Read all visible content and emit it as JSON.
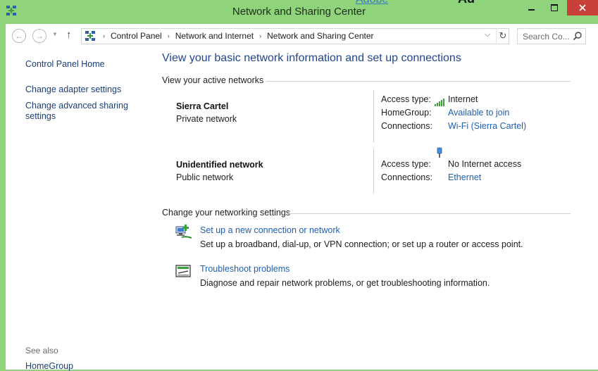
{
  "window": {
    "title": "Network and Sharing Center",
    "peek_text_1": "Adobe",
    "peek_text_2": "Ad"
  },
  "nav": {
    "back": "←",
    "forward": "→",
    "recent": "▼",
    "up": "↑"
  },
  "address": {
    "crumbs": [
      "Control Panel",
      "Network and Internet",
      "Network and Sharing Center"
    ],
    "separator": "›",
    "dropdown": "⌵",
    "refresh": "↻"
  },
  "search": {
    "placeholder": "Search Co..."
  },
  "sidebar": {
    "items": [
      {
        "label": "Control Panel Home"
      },
      {
        "label": "Change adapter settings"
      },
      {
        "label": "Change advanced sharing settings"
      }
    ],
    "see_also": "See also",
    "see_also_items": [
      {
        "label": "HomeGroup"
      }
    ]
  },
  "main": {
    "title": "View your basic network information and set up connections",
    "active_networks_heading": "View your active networks",
    "networks": [
      {
        "name": "Sierra Cartel",
        "category": "Private network",
        "access_type_label": "Access type:",
        "access_type_value": "Internet",
        "homegroup_label": "HomeGroup:",
        "homegroup_value": "Available to join",
        "connections_label": "Connections:",
        "connections_value": "Wi-Fi (Sierra Cartel)"
      },
      {
        "name": "Unidentified network",
        "category": "Public network",
        "access_type_label": "Access type:",
        "access_type_value": "No Internet access",
        "connections_label": "Connections:",
        "connections_value": "Ethernet"
      }
    ],
    "settings_heading": "Change your networking settings",
    "tasks": [
      {
        "link": "Set up a new connection or network",
        "desc": "Set up a broadband, dial-up, or VPN connection; or set up a router or access point."
      },
      {
        "link": "Troubleshoot problems",
        "desc": "Diagnose and repair network problems, or get troubleshooting information."
      }
    ]
  },
  "colors": {
    "titlebar": "#8fd47a",
    "link": "#1e5fb4",
    "close_button": "#c7403a"
  },
  "icons": {
    "app": "network-icon",
    "wifi": "wifi-signal-icon",
    "ethernet": "ethernet-plug-icon",
    "new_connection": "new-connection-icon",
    "troubleshoot": "troubleshoot-icon"
  }
}
